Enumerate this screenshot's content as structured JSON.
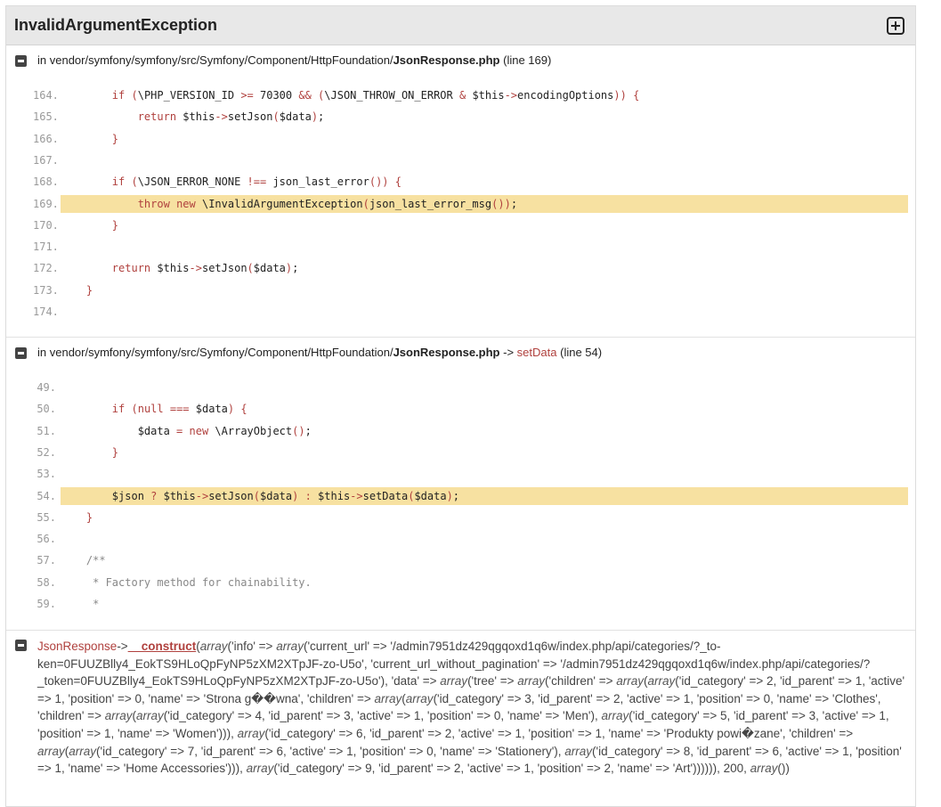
{
  "header": {
    "title": "InvalidArgumentException"
  },
  "traces": [
    {
      "prefix": "in vendor/symfony/symfony/src/Symfony/Component/HttpFoundation/",
      "file": "JsonResponse.php",
      "line_info": "(line 169)",
      "lines": [
        {
          "n": "164.",
          "code": "        if (\\PHP_VERSION_ID >= 70300 && (\\JSON_THROW_ON_ERROR & $this->encodingOptions)) {"
        },
        {
          "n": "165.",
          "code": "            return $this->setJson($data);"
        },
        {
          "n": "166.",
          "code": "        }"
        },
        {
          "n": "167.",
          "code": ""
        },
        {
          "n": "168.",
          "code": "        if (\\JSON_ERROR_NONE !== json_last_error()) {"
        },
        {
          "n": "169.",
          "code": "            throw new \\InvalidArgumentException(json_last_error_msg());",
          "highlight": true
        },
        {
          "n": "170.",
          "code": "        }"
        },
        {
          "n": "171.",
          "code": ""
        },
        {
          "n": "172.",
          "code": "        return $this->setJson($data);"
        },
        {
          "n": "173.",
          "code": "    }"
        },
        {
          "n": "174.",
          "code": ""
        }
      ]
    },
    {
      "prefix": "in vendor/symfony/symfony/src/Symfony/Component/HttpFoundation/",
      "file": "JsonResponse.php",
      "arrow": "->",
      "method": "setData",
      "line_info": "(line 54)",
      "lines": [
        {
          "n": "49.",
          "code": ""
        },
        {
          "n": "50.",
          "code": "        if (null === $data) {"
        },
        {
          "n": "51.",
          "code": "            $data = new \\ArrayObject();"
        },
        {
          "n": "52.",
          "code": "        }"
        },
        {
          "n": "53.",
          "code": ""
        },
        {
          "n": "54.",
          "code": "        $json ? $this->setJson($data) : $this->setData($data);",
          "highlight": true
        },
        {
          "n": "55.",
          "code": "    }"
        },
        {
          "n": "56.",
          "code": ""
        },
        {
          "n": "57.",
          "code": "    /**"
        },
        {
          "n": "58.",
          "code": "     * Factory method for chainability."
        },
        {
          "n": "59.",
          "code": "     *"
        }
      ]
    }
  ],
  "call": {
    "class": "JsonResponse",
    "arrow": "->",
    "method": "__construct",
    "args_text": "(array('info' => array('current_url' => '/admin7951dz429qgqoxd1q6w/index.php/api/categories/?_to-ken=0FUUZBlly4_EokTS9HLoQpFyNP5zXM2XTpJF-zo-U5o', 'current_url_without_pagination' => '/admin7951dz429qgqoxd1q6w/index.php/api/categories/?_token=0FUUZBlly4_EokTS9HLoQpFyNP5zXM2XTpJF-zo-U5o'), 'data' => array('tree' => array('children' => array(array('id_category' => 2, 'id_parent' => 1, 'active' => 1, 'position' => 0, 'name' => 'Strona g��wna', 'children' => array(array('id_category' => 3, 'id_parent' => 2, 'active' => 1, 'position' => 0, 'name' => 'Clothes', 'children' => array(array('id_category' => 4, 'id_parent' => 3, 'active' => 1, 'position' => 0, 'name' => 'Men'), array('id_category' => 5, 'id_parent' => 3, 'active' => 1, 'position' => 1, 'name' => 'Women'))), array('id_category' => 6, 'id_parent' => 2, 'active' => 1, 'position' => 1, 'name' => 'Produkty powi�zane', 'children' => array(array('id_category' => 7, 'id_parent' => 6, 'active' => 1, 'position' => 0, 'name' => 'Stationery'), array('id_category' => 8, 'id_parent' => 6, 'active' => 1, 'position' => 1, 'name' => 'Home Accessories'))), array('id_category' => 9, 'id_parent' => 2, 'active' => 1, 'position' => 2, 'name' => 'Art')))))), 200, array())"
  }
}
